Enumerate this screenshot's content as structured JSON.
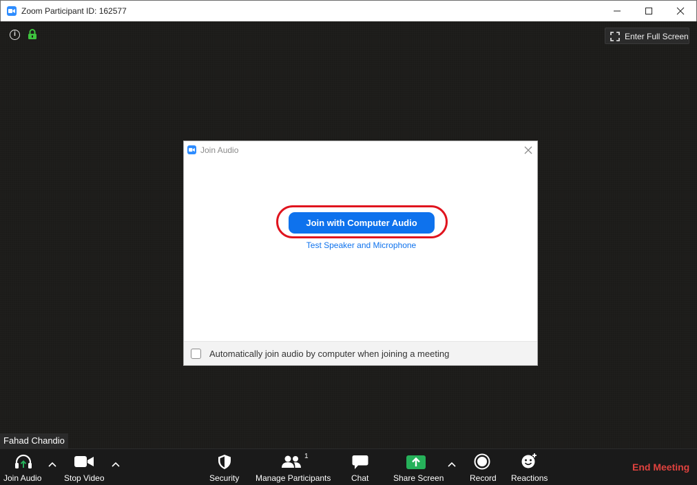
{
  "window": {
    "title": "Zoom Participant ID: 162577"
  },
  "video": {
    "fullscreen_label": "Enter Full Screen",
    "participant_name": "Fahad Chandio"
  },
  "dialog": {
    "title": "Join Audio",
    "join_button": "Join with Computer Audio",
    "test_link": "Test Speaker and Microphone",
    "auto_join_label": "Automatically join audio by computer when joining a meeting",
    "auto_join_checked": false
  },
  "toolbar": {
    "join_audio": "Join Audio",
    "stop_video": "Stop Video",
    "security": "Security",
    "manage_participants": "Manage Participants",
    "participant_count": "1",
    "chat": "Chat",
    "share_screen": "Share Screen",
    "record": "Record",
    "reactions": "Reactions",
    "end_meeting": "End Meeting"
  },
  "colors": {
    "accent_blue": "#0e72ed",
    "zoom_blue": "#2d8cff",
    "highlight_red": "#e0141e",
    "share_green": "#26b15a",
    "end_red": "#e0423e"
  },
  "icons": {
    "app": "zoom-camera-icon",
    "info": "info-icon",
    "lock": "lock-icon",
    "fullscreen": "fullscreen-icon",
    "join_audio": "headphones-icon",
    "stop_video": "video-camera-icon",
    "security": "shield-icon",
    "participants": "people-icon",
    "chat": "chat-bubble-icon",
    "share": "share-screen-icon",
    "record": "record-icon",
    "reactions": "smiley-icon"
  }
}
